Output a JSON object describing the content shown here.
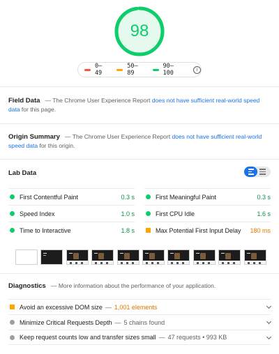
{
  "score": {
    "value": "98",
    "fraction": 0.98,
    "color": "#0cce6b",
    "track_color": "#e6f9ef"
  },
  "legend": {
    "items": [
      {
        "range": "0–49",
        "color": "#ff4e42"
      },
      {
        "range": "50–89",
        "color": "#ffa400"
      },
      {
        "range": "90–100",
        "color": "#0cce6b"
      }
    ],
    "info_icon": "info-icon"
  },
  "field_data": {
    "title": "Field Data",
    "sep": "—",
    "text_before": "The Chrome User Experience Report",
    "link": "does not have sufficient real-world speed data",
    "text_after": "for this page."
  },
  "origin_summary": {
    "title": "Origin Summary",
    "sep": "—",
    "text_before": "The Chrome User Experience Report",
    "link": "does not have sufficient real-world speed data",
    "text_after": "for this origin."
  },
  "lab_data": {
    "title": "Lab Data",
    "toggle_icons": [
      "list-view-icon",
      "compact-view-icon"
    ],
    "metrics": [
      {
        "label": "First Contentful Paint",
        "value": "0.3 s",
        "status": "pass",
        "color": "#0cce6b"
      },
      {
        "label": "First Meaningful Paint",
        "value": "0.3 s",
        "status": "pass",
        "color": "#0cce6b"
      },
      {
        "label": "Speed Index",
        "value": "1.0 s",
        "status": "pass",
        "color": "#0cce6b"
      },
      {
        "label": "First CPU Idle",
        "value": "1.6 s",
        "status": "pass",
        "color": "#0cce6b"
      },
      {
        "label": "Time to Interactive",
        "value": "1.8 s",
        "status": "pass",
        "color": "#0cce6b"
      },
      {
        "label": "Max Potential First Input Delay",
        "value": "180 ms",
        "status": "average",
        "color": "#e67700"
      }
    ]
  },
  "filmstrip": {
    "frames": [
      "blank",
      "dark-hero",
      "dark-page",
      "dark-page",
      "dark-page",
      "dark-page",
      "dark-page",
      "dark-page",
      "dark-page",
      "dark-page"
    ]
  },
  "diagnostics": {
    "title": "Diagnostics",
    "sep": "—",
    "description": "More information about the performance of your application.",
    "items": [
      {
        "label": "Avoid an excessive DOM size",
        "sep": "—",
        "detail": "1,001 elements",
        "status": "warn"
      },
      {
        "label": "Minimize Critical Requests Depth",
        "sep": "—",
        "detail": "5 chains found",
        "status": "info"
      },
      {
        "label": "Keep request counts low and transfer sizes small",
        "sep": "—",
        "detail": "47 requests • 993 KB",
        "status": "info"
      }
    ]
  }
}
